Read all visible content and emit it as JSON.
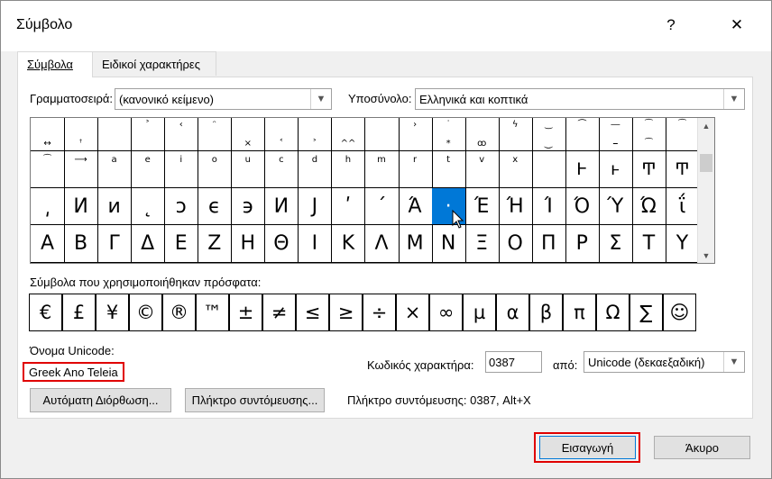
{
  "window": {
    "title": "Σύμβολο",
    "help": "?",
    "close": "✕"
  },
  "tabs": [
    "Σύμβολα",
    "Ειδικοί χαρακτήρες"
  ],
  "font": {
    "label": "Γραμματοσειρά:",
    "value": "(κανονικό κείμενο)"
  },
  "subset": {
    "label": "Υποσύνολο:",
    "value": "Ελληνικά και κοπτικά"
  },
  "grid": {
    "rows": [
      [
        "↔",
        "ꜛ",
        "",
        "˃",
        "˂",
        "˞",
        "˕",
        "˖",
        "˰",
        "˱",
        "˲",
        "ˏ",
        "˳",
        "˯",
        "ˁ",
        "ˀ",
        "˘",
        "˯",
        "˘",
        "ˇ",
        "˘"
      ],
      [
        "˘",
        "⟶",
        "ª",
        "ᵉ",
        "ⁱ",
        "ᵒ",
        "ᵘ",
        "ᶜ",
        "ᵈ",
        "ʰ",
        "ᵐ",
        "ʳ",
        "ᵗ",
        "ᵛ",
        "ˣ",
        "",
        "Ͱ",
        "ͱ",
        "Ͳ",
        "ͳ",
        "ʹ"
      ],
      [
        "͵",
        "И",
        "и",
        "˛",
        "ɔ",
        "ϵ",
        "϶",
        "Ͷ",
        "Ϳ",
        "ʹ",
        "΄",
        "Ά",
        "·",
        "Έ",
        "Ή",
        "Ί",
        "Ό",
        "Ύ",
        "Ώ",
        "ΐ"
      ],
      [
        "Α",
        "Β",
        "Γ",
        "Δ",
        "Ε",
        "Ζ",
        "Η",
        "Θ",
        "Ι",
        "Κ",
        "Λ",
        "Μ",
        "Ν",
        "Ξ",
        "Ο",
        "Π",
        "Ρ",
        "Σ",
        "Τ",
        "Υ"
      ]
    ],
    "row_tops_visible": [
      [
        "",
        "",
        "",
        "˃",
        "‹",
        "ᵔ",
        "",
        "",
        "",
        "",
        "",
        "›",
        "˙",
        "",
        "ϟ",
        "‿",
        "⏜",
        "―",
        "͡",
        "⁀"
      ],
      [
        "",
        "",
        "",
        "",
        "",
        "",
        "",
        "",
        "",
        "",
        "",
        "",
        "",
        "",
        "",
        "",
        "",
        "",
        "",
        ""
      ]
    ],
    "row1_labels": [
      "↔",
      "ꜛ",
      "",
      "",
      "",
      "",
      "˟",
      "<",
      ">",
      "^^",
      "",
      "",
      "",
      "",
      "",
      "",
      "",
      "",
      "",
      ""
    ],
    "row1_marks": [
      "",
      "",
      "",
      "",
      "",
      "",
      "×",
      "˂",
      "˃",
      "^^",
      "",
      "",
      "*",
      "ꚙ",
      "",
      "⏝",
      "",
      "⎯",
      "͡",
      ""
    ],
    "row2_small": [
      "⁀",
      "⟶",
      "a",
      "e",
      "i",
      "o",
      "u",
      "c",
      "d",
      "h",
      "m",
      "r",
      "t",
      "v",
      "x",
      "",
      "Ⱶ",
      "ⱶ",
      "Ͳ",
      "Ͳ",
      "ʹ"
    ],
    "selected": {
      "row": 2,
      "col": 12
    }
  },
  "recent": {
    "label": "Σύμβολα που χρησιμοποιήθηκαν πρόσφατα:",
    "items": [
      "€",
      "£",
      "¥",
      "©",
      "®",
      "™",
      "±",
      "≠",
      "≤",
      "≥",
      "÷",
      "×",
      "∞",
      "µ",
      "α",
      "β",
      "π",
      "Ω",
      "∑",
      "☺"
    ]
  },
  "unicode_name": {
    "label": "Όνομα Unicode:",
    "value": "Greek Ano Teleia"
  },
  "char_code": {
    "label": "Κωδικός χαρακτήρα:",
    "value": "0387"
  },
  "from": {
    "label": "από:",
    "value": "Unicode (δεκαεξαδική)"
  },
  "buttons": {
    "autocorrect": "Αυτόματη Διόρθωση...",
    "shortcut_key": "Πλήκτρο συντόμευσης...",
    "insert": "Εισαγωγή",
    "cancel": "Άκυρο"
  },
  "shortcut_info": "Πλήκτρο συντόμευσης: 0387, Alt+X"
}
